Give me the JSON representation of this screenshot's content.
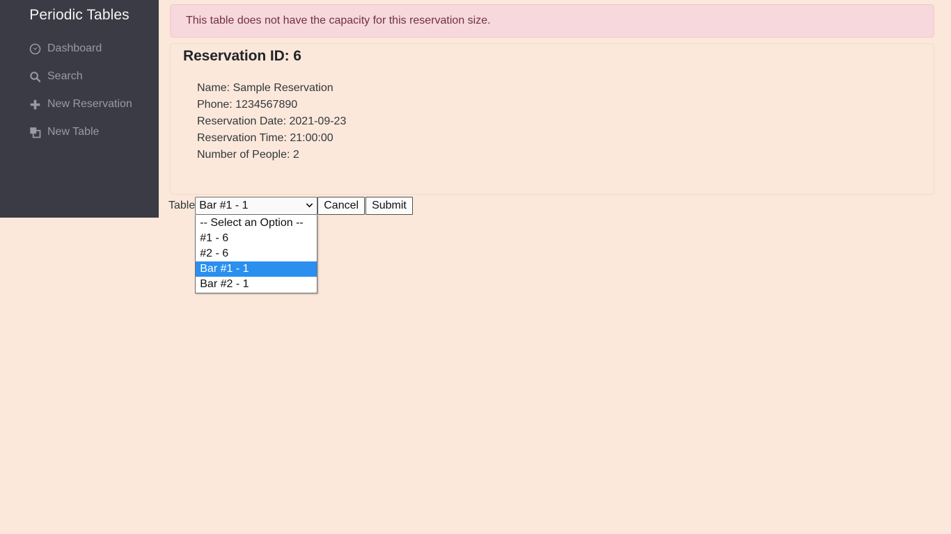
{
  "sidebar": {
    "brand": "Periodic Tables",
    "items": [
      {
        "label": "Dashboard",
        "icon": "dashboard-icon"
      },
      {
        "label": "Search",
        "icon": "search-icon"
      },
      {
        "label": "New Reservation",
        "icon": "plus-icon"
      },
      {
        "label": "New Table",
        "icon": "clone-icon"
      }
    ]
  },
  "alert": {
    "message": "This table does not have the capacity for this reservation size."
  },
  "reservation": {
    "title": "Reservation ID: 6",
    "lines": [
      "Name: Sample Reservation",
      "Phone: 1234567890",
      "Reservation Date: 2021-09-23",
      "Reservation Time: 21:00:00",
      "Number of People: 2"
    ]
  },
  "form": {
    "table_label": "Table",
    "select": {
      "value": "Bar #1 - 1",
      "options": [
        "-- Select an Option --",
        "#1 - 6",
        "#2 - 6",
        "Bar #1 - 1",
        "Bar #2 - 1"
      ],
      "selected_index": 3
    },
    "cancel_label": "Cancel",
    "submit_label": "Submit"
  },
  "colors": {
    "page_bg": "#fbe8da",
    "sidebar_bg": "#3b3b45",
    "alert_bg": "#f6d8dd",
    "alert_border": "#f2c7ce",
    "alert_text": "#72303f",
    "card_border": "#efdccd",
    "highlight": "#2a8fef",
    "nav_text": "#9a9aa3",
    "brand_text": "#f4f4f6"
  }
}
